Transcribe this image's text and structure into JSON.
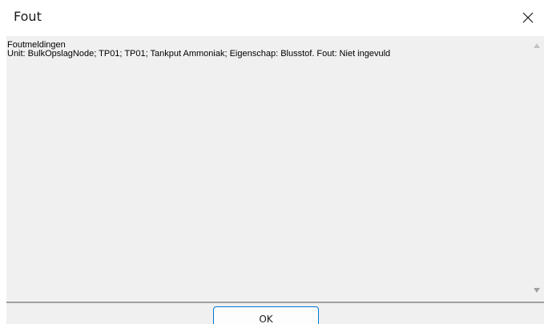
{
  "window": {
    "title": "Fout",
    "close_icon": "close-icon"
  },
  "message": {
    "heading": "Foutmeldingen",
    "line": "Unit: BulkOpslagNode; TP01; TP01; Tankput Ammoniak; Eigenschap: Blusstof. Fout: Niet ingevuld"
  },
  "buttons": {
    "ok_label": "OK"
  },
  "colors": {
    "text_area_bg": "#f0f0f0",
    "button_border": "#0078d4"
  }
}
